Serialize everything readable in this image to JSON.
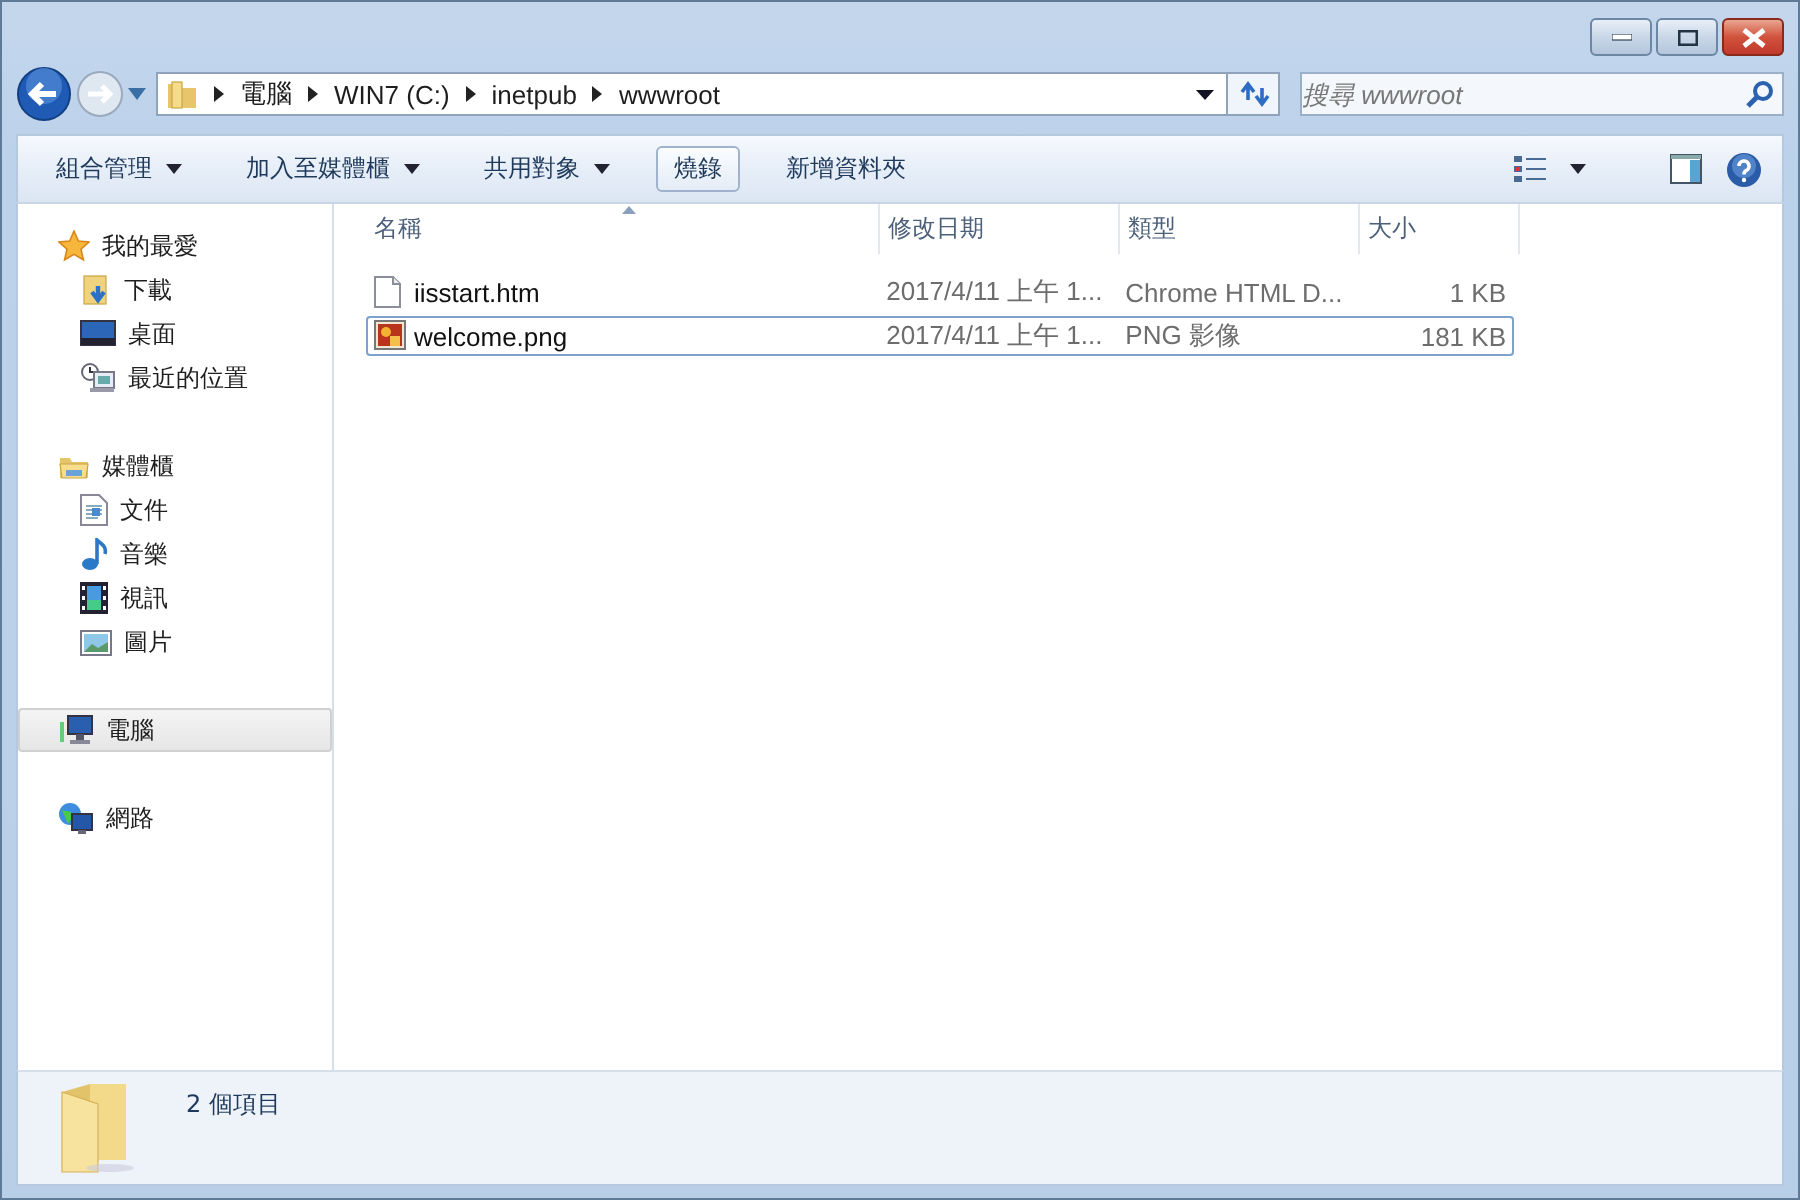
{
  "address": {
    "crumbs": [
      "電腦",
      "WIN7 (C:)",
      "inetpub",
      "wwwroot"
    ]
  },
  "search": {
    "placeholder": "搜尋 wwwroot"
  },
  "toolbar": [
    {
      "label": "組合管理",
      "dropdown": true,
      "highlighted": false
    },
    {
      "label": "加入至媒體櫃",
      "dropdown": true,
      "highlighted": false
    },
    {
      "label": "共用對象",
      "dropdown": true,
      "highlighted": false
    },
    {
      "label": "燒錄",
      "dropdown": false,
      "highlighted": true
    },
    {
      "label": "新增資料夾",
      "dropdown": false,
      "highlighted": false
    }
  ],
  "sidebar": [
    {
      "label": "我的最愛",
      "selected": false,
      "children": [
        {
          "label": "下載",
          "selected": false
        },
        {
          "label": "桌面",
          "selected": false
        },
        {
          "label": "最近的位置",
          "selected": false
        }
      ]
    },
    {
      "label": "媒體櫃",
      "selected": false,
      "children": [
        {
          "label": "文件",
          "selected": false
        },
        {
          "label": "音樂",
          "selected": false
        },
        {
          "label": "視訊",
          "selected": false
        },
        {
          "label": "圖片",
          "selected": false
        }
      ]
    },
    {
      "label": "電腦",
      "selected": true
    },
    {
      "label": "網路",
      "selected": false
    }
  ],
  "table": {
    "columns": [
      {
        "label": "名稱",
        "sorted": true
      },
      {
        "label": "修改日期",
        "sorted": false
      },
      {
        "label": "類型",
        "sorted": false
      },
      {
        "label": "大小",
        "sorted": false
      }
    ],
    "rows": [
      {
        "name": "iisstart.htm",
        "date": "2017/4/11 上午 1...",
        "type": "Chrome HTML D...",
        "size": "1 KB",
        "selected": false
      },
      {
        "name": "welcome.png",
        "date": "2017/4/11 上午 1...",
        "type": "PNG 影像",
        "size": "181 KB",
        "selected": true
      }
    ]
  },
  "status_bar": {
    "text": "2 個項目"
  }
}
